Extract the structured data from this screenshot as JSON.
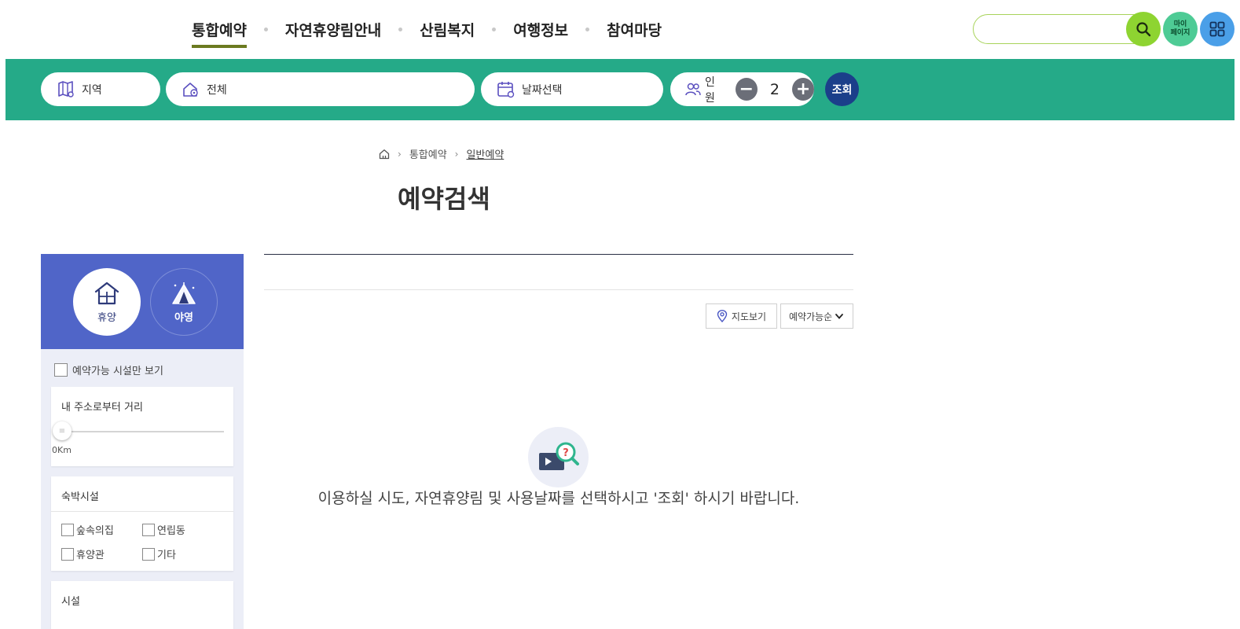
{
  "header": {
    "nav": [
      {
        "label": "통합예약",
        "active": true
      },
      {
        "label": "자연휴양림안내",
        "active": false
      },
      {
        "label": "산림복지",
        "active": false
      },
      {
        "label": "여행정보",
        "active": false
      },
      {
        "label": "참여마당",
        "active": false
      }
    ],
    "search_placeholder": "",
    "my_page_label_line1": "마이",
    "my_page_label_line2": "페이지"
  },
  "quickbar": {
    "region_label": "지역",
    "forest_label": "전체",
    "date_label": "날짜선택",
    "people_label": "인원",
    "people_count": "2",
    "minus_symbol": "−",
    "plus_symbol": "+",
    "submit_label": "조회"
  },
  "breadcrumb": {
    "level1": "통합예약",
    "level2": "일반예약"
  },
  "page_title": "예약검색",
  "sidebar": {
    "types": [
      {
        "label": "휴양",
        "active": true
      },
      {
        "label": "야영",
        "active": false
      }
    ],
    "available_only_label": "예약가능 시설만 보기",
    "distance": {
      "title": "내 주소로부터 거리",
      "value_label": "0Km"
    },
    "lodging": {
      "title": "숙박시설",
      "options": [
        "숲속의집",
        "연립동",
        "휴양관",
        "기타"
      ]
    },
    "facility": {
      "title": "시설"
    }
  },
  "main": {
    "map_button_label": "지도보기",
    "sort_selected": "예약가능순",
    "empty_message": "이용하실 시도, 자연휴양림 및 사용날짜를 선택하시고 '조회' 하시기 바랍니다."
  },
  "colors": {
    "quickbar_bg": "#25aa88",
    "sidebar_header_bg": "#5065c8",
    "submit_bg": "#1b3f8a",
    "search_btn_bg": "#8ed431",
    "my_page_bg": "#4ecb95",
    "menu_bg": "#4a9fe8",
    "nav_active_underline": "#6b7a20"
  }
}
